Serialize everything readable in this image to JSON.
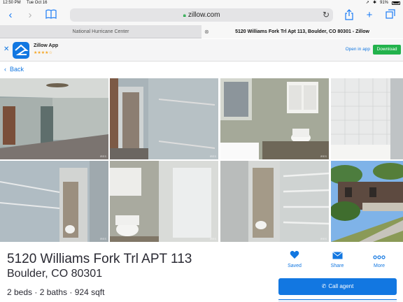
{
  "status_bar": {
    "time": "12:50 PM",
    "date": "Tue Oct 16",
    "battery": "91%"
  },
  "toolbar": {
    "url": "zillow.com"
  },
  "tabs": [
    {
      "label": "National Hurricane Center"
    },
    {
      "label": "5120 Williams Fork Trl Apt 113, Boulder, CO 80301 - Zillow"
    }
  ],
  "app_banner": {
    "name": "Zillow App",
    "rating": "★★★★☆",
    "open_in_app": "Open in app",
    "download": "Download"
  },
  "nav": {
    "back_label": "Back"
  },
  "listing": {
    "address_line1": "5120 Williams Fork Trl APT 113",
    "address_line2": "Boulder, CO 80301",
    "facts": "2 beds · 2 baths · 924 sqft",
    "actions": {
      "saved": "Saved",
      "share": "Share",
      "more": "More"
    },
    "call_agent": "Call agent",
    "photo_watermark": "IRES"
  },
  "colors": {
    "accent": "#1277e1",
    "download": "#22b24c"
  }
}
